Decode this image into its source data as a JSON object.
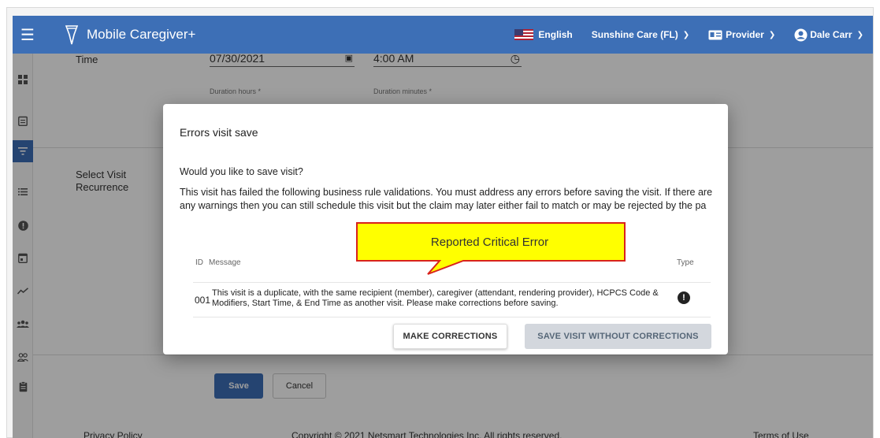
{
  "appbar": {
    "brand": "Mobile Caregiver+",
    "language": "English",
    "agency": "Sunshine Care (FL)",
    "role": "Provider",
    "user": "Dale Carr"
  },
  "sidebar": {
    "icons": [
      "dashboard-icon",
      "calendar-note-icon",
      "filter-icon",
      "list-icon",
      "alert-icon",
      "event-icon",
      "trend-icon",
      "group-icon",
      "people-outline-icon",
      "clipboard-icon"
    ],
    "active_index": 2
  },
  "form": {
    "time_label": "Time",
    "date_value": "07/30/2021",
    "time_value": "4:00 AM",
    "duration_hours_label": "Duration hours *",
    "duration_minutes_label": "Duration minutes *",
    "recurrence_label": "Select Visit Recurrence",
    "save_label": "Save",
    "cancel_label": "Cancel"
  },
  "footer": {
    "privacy": "Privacy Policy",
    "copyright": "Copyright © 2021 Netsmart Technologies Inc. All rights reserved.",
    "terms": "Terms of Use"
  },
  "modal": {
    "title": "Errors visit save",
    "question": "Would you like to save visit?",
    "description": "This visit has failed the following business rule validations. You must address any errors before saving the visit. If there are any warnings then you can still schedule this visit but the claim may later either fail to match or may be rejected by the pa",
    "columns": {
      "id": "ID",
      "message": "Message",
      "type": "Type"
    },
    "rows": [
      {
        "id": "001",
        "message": "This visit is a duplicate, with the same recipient (member), caregiver (attendant, rendering provider), HCPCS Code & Modifiers, Start Time, & End Time as another visit. Please make corrections before saving.",
        "type_icon": "error-icon"
      }
    ],
    "make_corrections_label": "MAKE CORRECTIONS",
    "save_without_label": "SAVE VISIT WITHOUT CORRECTIONS"
  },
  "callout": {
    "text": "Reported Critical Error",
    "fill": "#ffff00",
    "border": "#d9221c"
  },
  "colors": {
    "primary": "#3d6fb6",
    "disabled_button": "#d3d7dd"
  }
}
